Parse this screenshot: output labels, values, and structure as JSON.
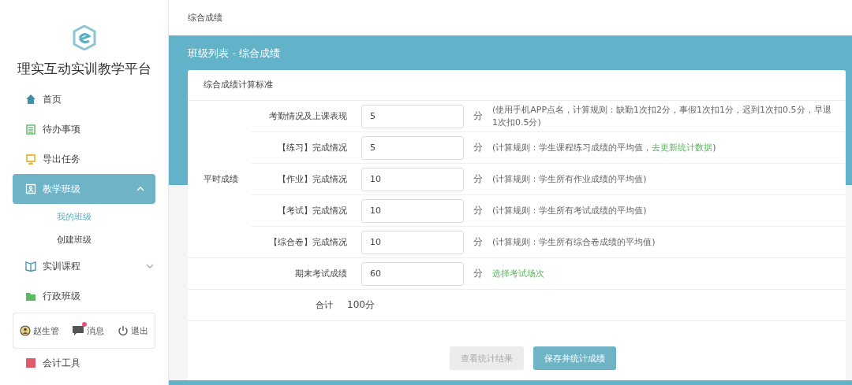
{
  "sidebar": {
    "title": "理实互动实训教学平台",
    "items": [
      {
        "label": "首页",
        "selected": false
      },
      {
        "label": "待办事项",
        "selected": false
      },
      {
        "label": "导出任务",
        "selected": false
      },
      {
        "label": "教学班级",
        "selected": true,
        "expanded": true,
        "children": [
          {
            "label": "我的班级",
            "selected": true
          },
          {
            "label": "创建班级",
            "selected": false
          }
        ]
      },
      {
        "label": "实训课程",
        "selected": false,
        "expanded": false
      },
      {
        "label": "行政班级",
        "selected": false
      }
    ],
    "footer": {
      "user": "赵生管",
      "messages": "消息",
      "unread": true,
      "logout": "退出"
    },
    "cut_item": "会计工具"
  },
  "breadcrumb": "综合成绩",
  "page_title": "班级列表 - 综合成绩",
  "card": {
    "title": "综合成绩计算标准",
    "sections": [
      {
        "label": "平时成绩",
        "rows": [
          {
            "label": "考勤情况及上课表现",
            "value": "5",
            "unit": "分",
            "note": "(使用手机APP点名，计算规则：缺勤1次扣2分，事假1次扣1分，迟到1次扣0.5分，早退1次扣0.5分)"
          },
          {
            "label": "【练习】完成情况",
            "value": "5",
            "unit": "分",
            "note": "(计算规则：学生课程练习成绩的平均值，",
            "link": "去更新统计数据",
            "note_end": ")"
          },
          {
            "label": "【作业】完成情况",
            "value": "10",
            "unit": "分",
            "note": "(计算规则：学生所有作业成绩的平均值)"
          },
          {
            "label": "【考试】完成情况",
            "value": "10",
            "unit": "分",
            "note": "(计算规则：学生所有考试成绩的平均值)"
          },
          {
            "label": "【综合卷】完成情况",
            "value": "10",
            "unit": "分",
            "note": "(计算规则：学生所有综合卷成绩的平均值)"
          }
        ]
      },
      {
        "rows": [
          {
            "label": "期末考试成绩",
            "value": "60",
            "unit": "分",
            "link": "选择考试场次"
          }
        ]
      }
    ],
    "total": {
      "label": "合计",
      "value": "100分"
    },
    "buttons": [
      {
        "label": "查看统计结果",
        "disabled": true
      },
      {
        "label": "保存并统计成绩",
        "disabled": false
      }
    ]
  }
}
